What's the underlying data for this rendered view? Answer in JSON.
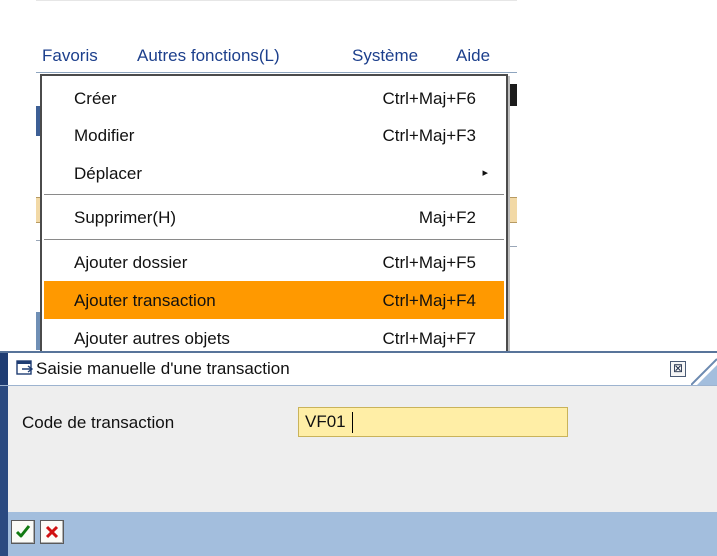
{
  "menubar": {
    "items": [
      {
        "label": "Favoris"
      },
      {
        "label": "Autres fonctions(L)"
      },
      {
        "label": "Système"
      },
      {
        "label": "Aide"
      }
    ]
  },
  "dropdown": {
    "items": [
      {
        "label": "Créer",
        "shortcut": "Ctrl+Maj+F6"
      },
      {
        "label": "Modifier",
        "shortcut": "Ctrl+Maj+F3"
      },
      {
        "label": "Déplacer",
        "shortcut": "",
        "submenu_arrow": "▸"
      },
      {
        "label": "Supprimer(H)",
        "shortcut": "Maj+F2"
      },
      {
        "label": "Ajouter dossier",
        "shortcut": "Ctrl+Maj+F5"
      },
      {
        "label": "Ajouter transaction",
        "shortcut": "Ctrl+Maj+F4"
      },
      {
        "label": "Ajouter autres objets",
        "shortcut": "Ctrl+Maj+F7"
      }
    ],
    "highlighted_index": 5,
    "highlight_color": "#ff9900"
  },
  "popup": {
    "title": "Saisie manuelle d'une transaction",
    "title_icon": "dialog-icon",
    "close_label": "⊠",
    "field": {
      "label": "Code de transaction",
      "value": "VF01"
    },
    "buttons": {
      "confirm_icon": "green-check-icon",
      "cancel_icon": "red-x-icon"
    }
  },
  "colors": {
    "menu_text": "#1c3f8c",
    "input_bg": "#ffeea6",
    "footer_bg": "#a3bedd",
    "frame_dark": "#2b4a80"
  }
}
